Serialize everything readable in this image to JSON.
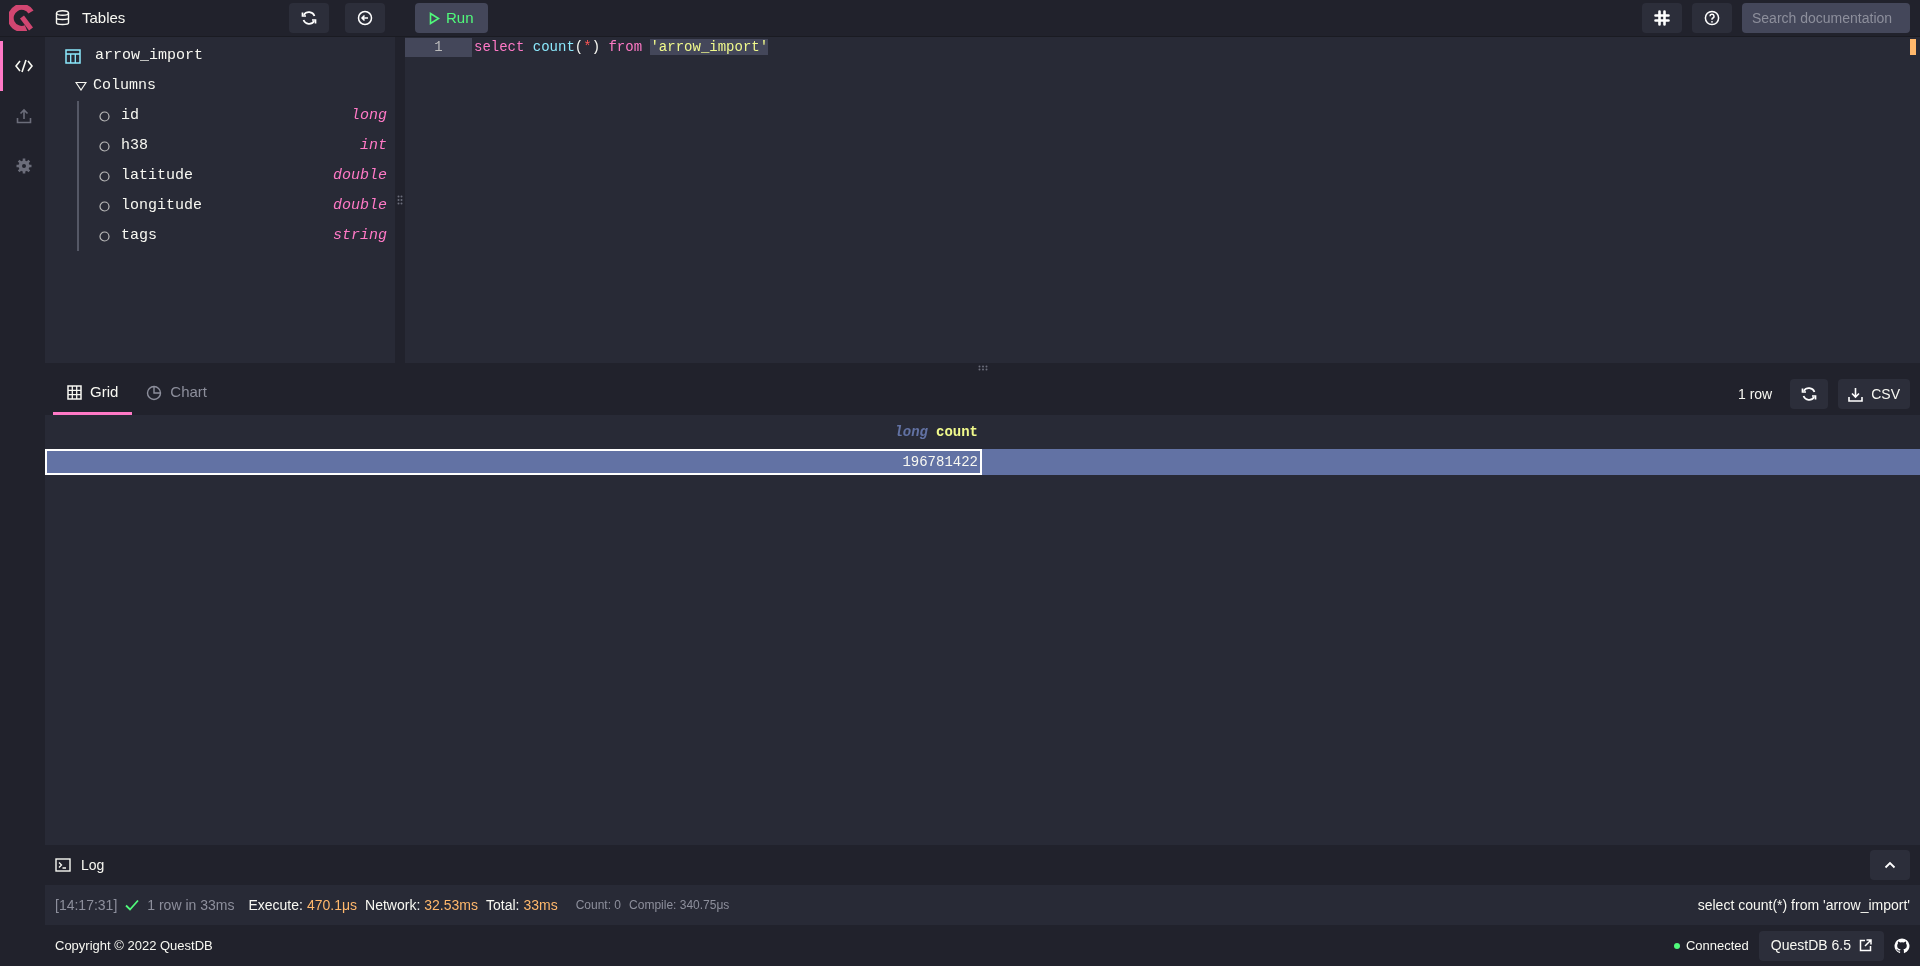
{
  "topbar": {
    "tables_label": "Tables",
    "run_label": "Run",
    "search": {
      "placeholder": "Search documentation"
    }
  },
  "rail": [
    {
      "kind": "code",
      "selected": true
    },
    {
      "kind": "upload",
      "selected": false
    },
    {
      "kind": "settings",
      "selected": false
    }
  ],
  "schema": {
    "table": "arrow_import",
    "group": {
      "label": "Columns",
      "expanded": true,
      "children": [
        {
          "name": "id",
          "type": "long"
        },
        {
          "name": "h38",
          "type": "int"
        },
        {
          "name": "latitude",
          "type": "double"
        },
        {
          "name": "longitude",
          "type": "double"
        },
        {
          "name": "tags",
          "type": "string"
        }
      ]
    }
  },
  "editor": {
    "lines": [
      {
        "number": "1",
        "tokens": [
          {
            "text": "select ",
            "kind": "keyword"
          },
          {
            "text": "count",
            "kind": "function"
          },
          {
            "text": "(",
            "kind": "punct"
          },
          {
            "text": "*",
            "kind": "operator"
          },
          {
            "text": ") ",
            "kind": "punct"
          },
          {
            "text": "from ",
            "kind": "keyword"
          },
          {
            "text": "'arrow_import'",
            "kind": "string"
          }
        ]
      }
    ]
  },
  "results": {
    "tabs": [
      {
        "label": "Grid",
        "kind": "grid",
        "selected": true
      },
      {
        "label": "Chart",
        "kind": "chart",
        "selected": false
      }
    ],
    "row_count": "1 row",
    "csv_label": "CSV",
    "columns": [
      {
        "type": "long",
        "name": "count"
      }
    ],
    "rows": [
      {
        "cells": [
          "196781422"
        ],
        "selected": true
      }
    ]
  },
  "log": {
    "label": "Log",
    "time": "[14:17:31]",
    "success": true,
    "summary": "1 row in 33ms",
    "metrics": [
      {
        "label": "Execute:",
        "value": "470.1μs"
      },
      {
        "label": "Network:",
        "value": "32.53ms"
      },
      {
        "label": "Total:",
        "value": "33ms"
      }
    ],
    "details": [
      "Count: 0",
      "Compile: 340.75μs"
    ],
    "query": "select count(*) from 'arrow_import'"
  },
  "footer": {
    "copyright": "Copyright © 2022 QuestDB",
    "connection": {
      "label": "Connected",
      "connected": true
    },
    "version": "QuestDB 6.5"
  }
}
